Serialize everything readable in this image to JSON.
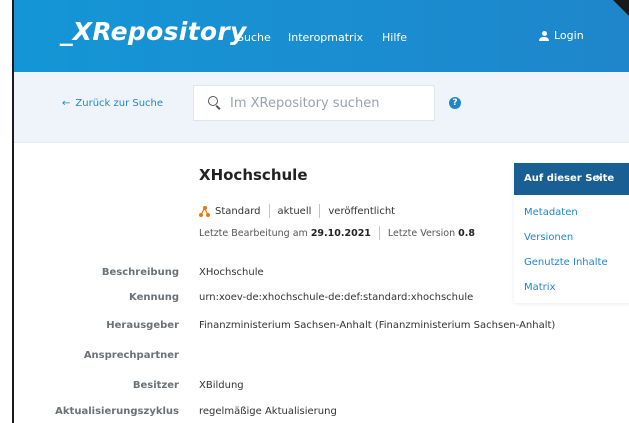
{
  "header": {
    "logo": "_XRepository",
    "nav": {
      "suche": "Suche",
      "interop": "Interopmatrix",
      "hilfe": "Hilfe"
    },
    "login_label": "Login"
  },
  "search": {
    "back_label": "Zurück zur Suche",
    "placeholder": "Im XRepository suchen",
    "help": "?"
  },
  "main": {
    "title": "XHochschule",
    "type_label": "Standard",
    "status_current": "aktuell",
    "status_published": "veröffentlicht",
    "last_edit_prefix": "Letzte Bearbeitung am",
    "last_edit_date": "29.10.2021",
    "last_version_prefix": "Letzte Version",
    "last_version": "0.8"
  },
  "details": [
    {
      "label": "Beschreibung",
      "value": "XHochschule"
    },
    {
      "label": "Kennung",
      "value": "urn:xoev-de:xhochschule-de:def:standard:xhochschule"
    },
    {
      "label": "Herausgeber",
      "value": "Finanzministerium Sachsen-Anhalt (Finanzministerium Sachsen-Anhalt)"
    },
    {
      "label": "Ansprechpartner",
      "value": ""
    },
    {
      "label": "Besitzer",
      "value": "XBildung"
    },
    {
      "label": "Aktualisierungszyklus",
      "value": "regelmäßige Aktualisierung"
    }
  ],
  "sidebar": {
    "title": "Auf dieser Seite",
    "chevron": "›",
    "links": [
      "Metadaten",
      "Versionen",
      "Genutzte Inhalte",
      "Matrix"
    ]
  },
  "colors": {
    "header_blue": "#1496d6",
    "link_blue": "#1f86cb",
    "sidebar_head": "#1a5f93",
    "standard_orange": "#e8780e"
  }
}
